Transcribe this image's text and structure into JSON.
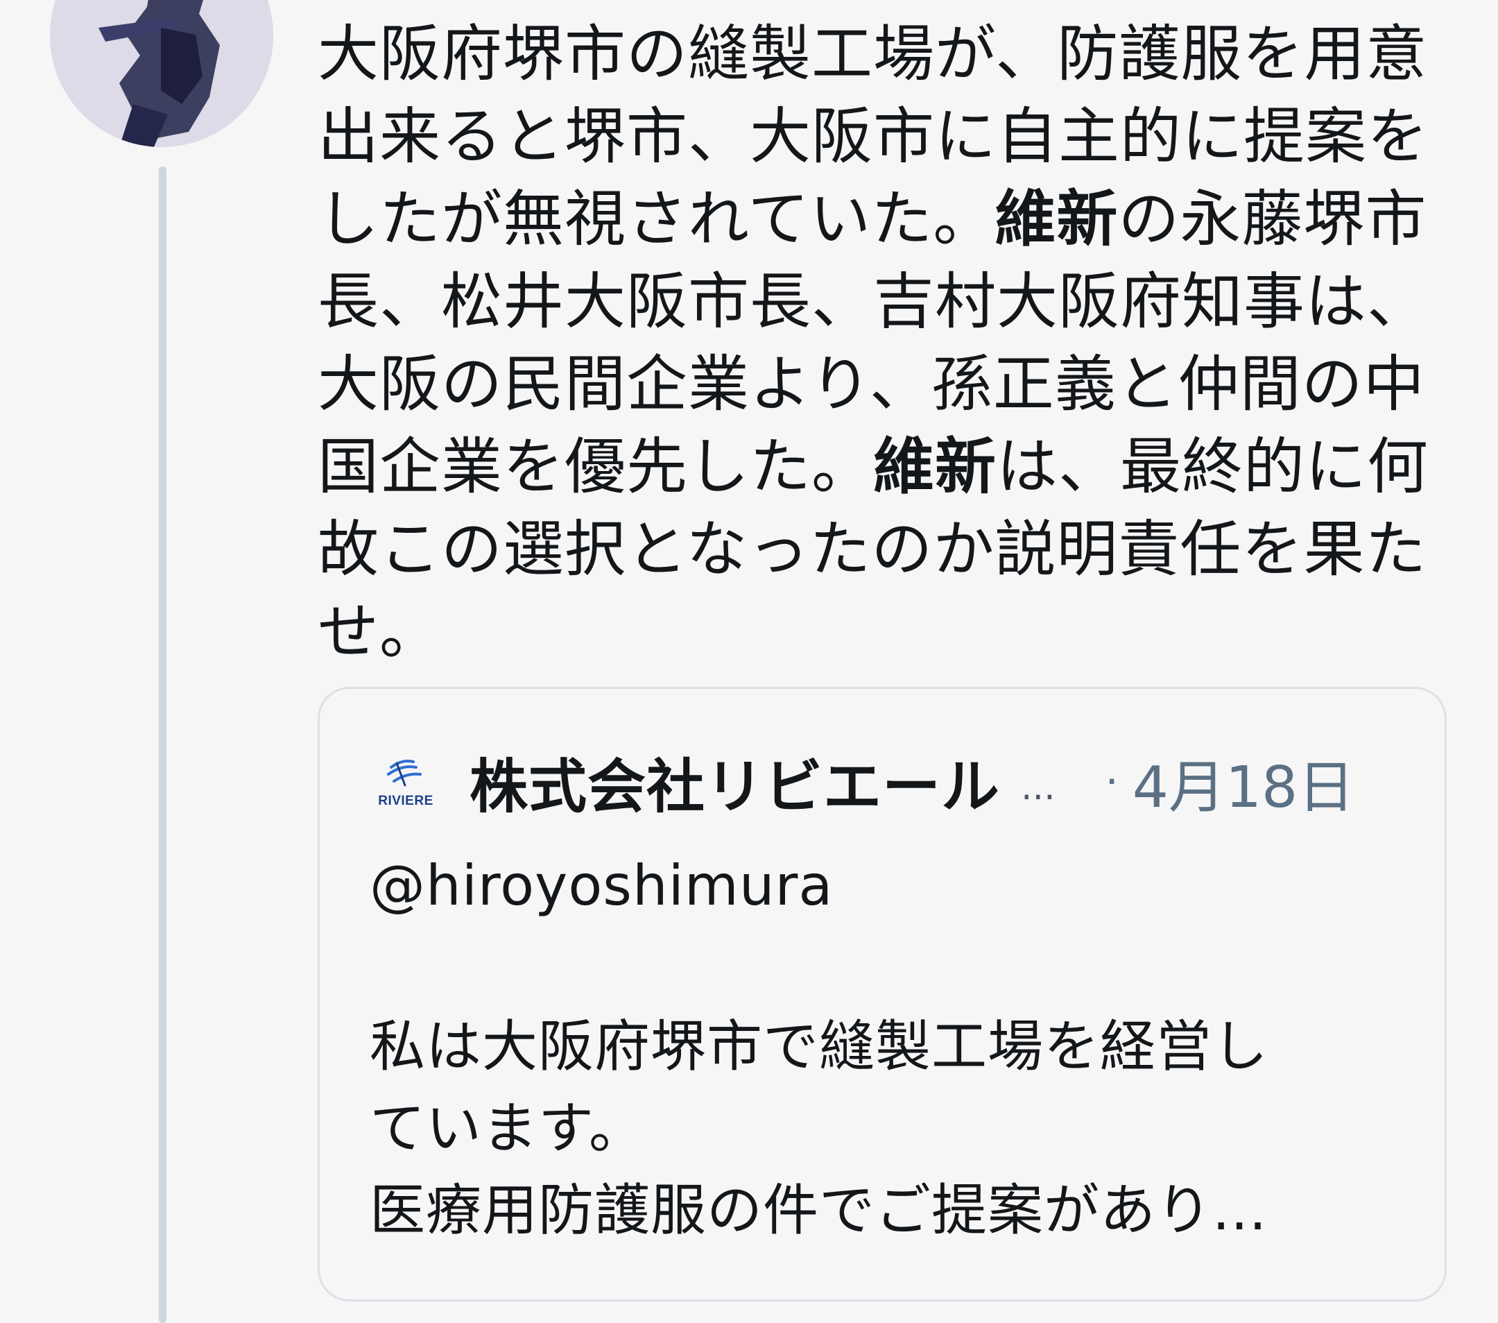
{
  "author": {
    "avatar_icon": "user-avatar-photo"
  },
  "tweet": {
    "lines": [
      [
        {
          "t": "大阪府堺市の縫製工場が、防護服を用意"
        }
      ],
      [
        {
          "t": "出来ると堺市、大阪市に自主的に提案を"
        }
      ],
      [
        {
          "t": "したが無視されていた。"
        },
        {
          "t": "維新",
          "b": true
        },
        {
          "t": "の永藤堺市"
        }
      ],
      [
        {
          "t": "長、松井大阪市長、吉村大阪府知事は、"
        }
      ],
      [
        {
          "t": "大阪の民間企業より、孫正義と仲間の中"
        }
      ],
      [
        {
          "t": "国企業を優先した。"
        },
        {
          "t": "維新",
          "b": true
        },
        {
          "t": "は、最終的に何"
        }
      ],
      [
        {
          "t": "故この選択となったのか説明責任を果た"
        }
      ],
      [
        {
          "t": "せ。"
        }
      ]
    ]
  },
  "quoted_tweet": {
    "brand_logo_text": "RIVIERE",
    "brand_logo_icon": "riviere-wave-logo-icon",
    "name": "株式会社リビエール",
    "name_truncation": "...",
    "separator": "·",
    "date": "4月18日",
    "mention": "@hiroyoshimura",
    "body_lines": [
      "私は大阪府堺市で縫製工場を経営し",
      "ています。",
      "医療用防護服の件でご提案があり..."
    ]
  },
  "colors": {
    "background": "#f6f6f7",
    "text": "#14171a",
    "muted": "#5b7083",
    "thread_line": "#cdd5de",
    "card_border": "#dbe1e7",
    "brand": "#1d3f8a"
  }
}
